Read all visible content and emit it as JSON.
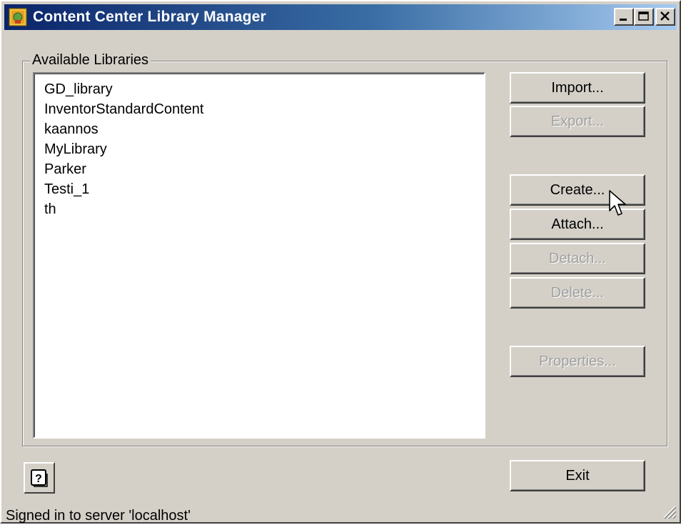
{
  "window": {
    "title": "Content Center Library Manager",
    "caption_buttons": [
      "minimize",
      "maximize",
      "close"
    ]
  },
  "libraries": {
    "group_label": "Available Libraries",
    "items": [
      {
        "label": "GD_library"
      },
      {
        "label": "InventorStandardContent"
      },
      {
        "label": "kaannos"
      },
      {
        "label": "MyLibrary"
      },
      {
        "label": "Parker"
      },
      {
        "label": "Testi_1"
      },
      {
        "label": "th"
      }
    ]
  },
  "buttons": {
    "import": {
      "label": "Import...",
      "enabled": true
    },
    "export": {
      "label": "Export...",
      "enabled": false
    },
    "create": {
      "label": "Create...",
      "enabled": true
    },
    "attach": {
      "label": "Attach...",
      "enabled": true
    },
    "detach": {
      "label": "Detach...",
      "enabled": false
    },
    "delete": {
      "label": "Delete...",
      "enabled": false
    },
    "properties": {
      "label": "Properties...",
      "enabled": false
    },
    "exit": {
      "label": "Exit",
      "enabled": true
    },
    "help": {
      "icon": "help-icon"
    }
  },
  "status_bar": {
    "text": "Signed in to server 'localhost'"
  }
}
